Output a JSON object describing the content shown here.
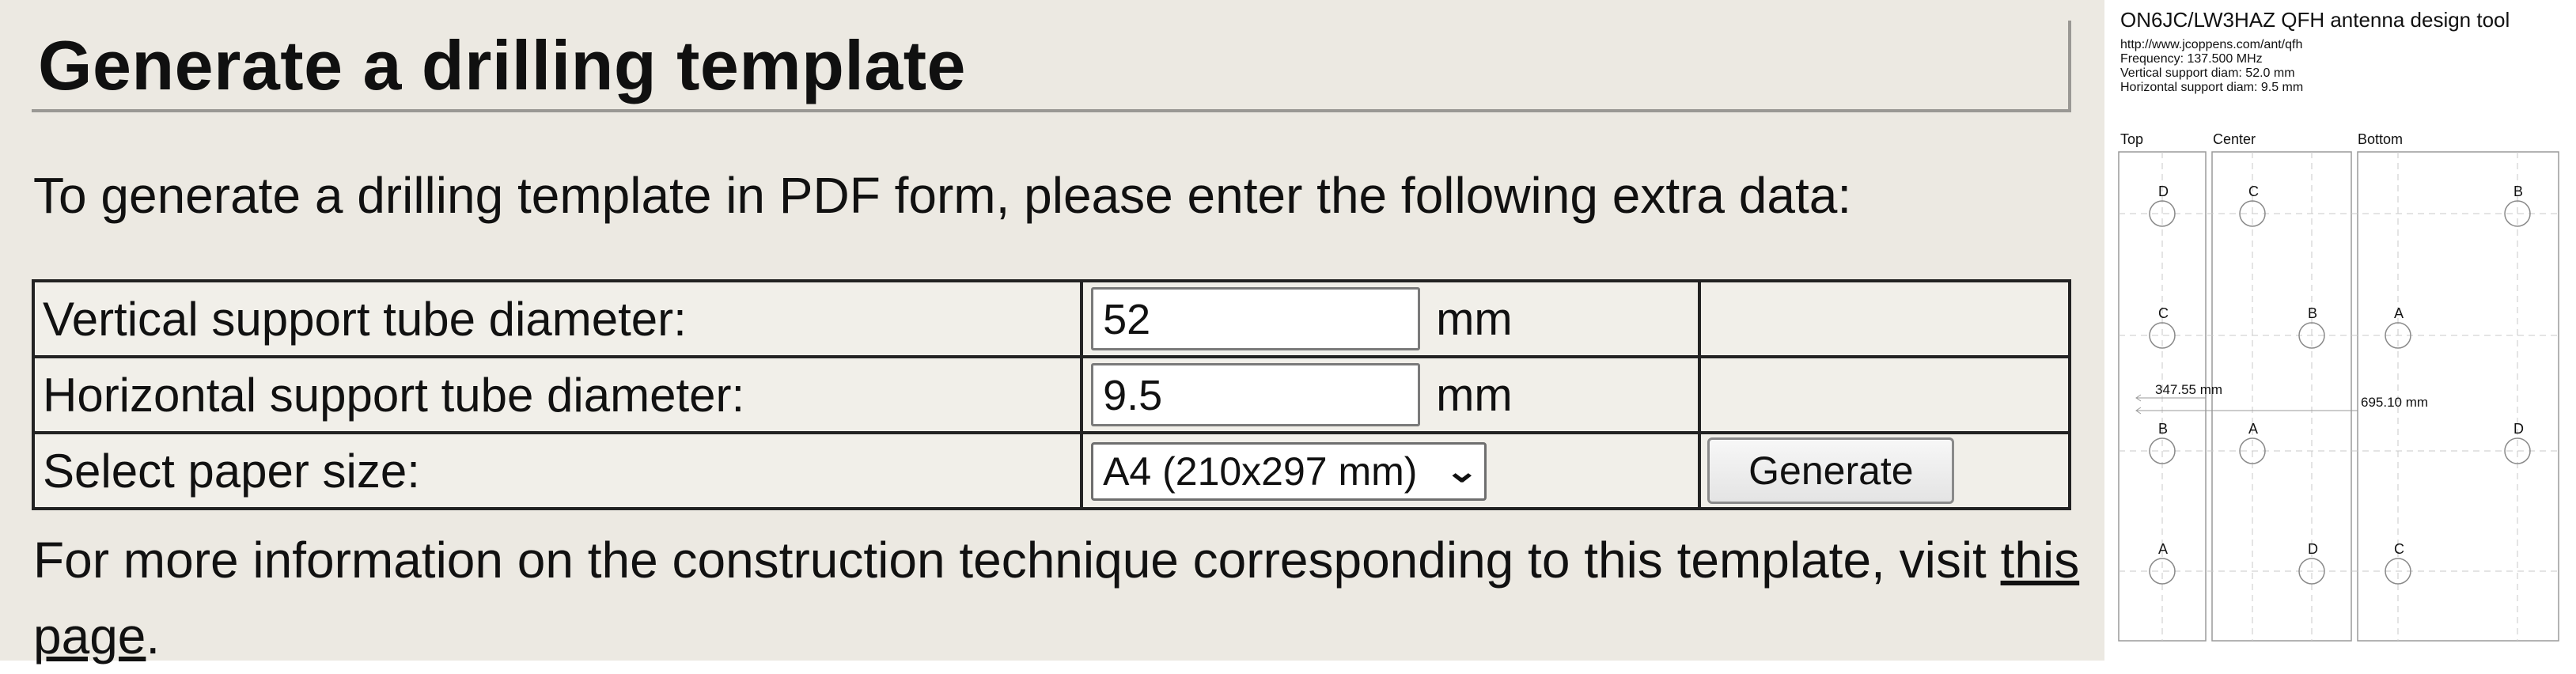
{
  "form": {
    "heading": "Generate a drilling template",
    "intro": "To generate a drilling template in PDF form, please enter the following extra data:",
    "rows": [
      {
        "label": "Vertical support tube diameter:",
        "value": "52",
        "unit": "mm"
      },
      {
        "label": "Horizontal support tube diameter:",
        "value": "9.5",
        "unit": "mm"
      },
      {
        "label": "Select paper size:",
        "selected": "A4 (210x297 mm)",
        "button": "Generate"
      }
    ],
    "more_info_text": "For more information on the construction technique corresponding to this template, visit ",
    "more_info_link": "this page",
    "more_info_end": "."
  },
  "preview": {
    "title": "ON6JC/LW3HAZ QFH antenna design tool",
    "lines": [
      "http://www.jcoppens.com/ant/qfh",
      "Frequency: 137.500 MHz",
      "Vertical support diam: 52.0 mm",
      "Horizontal support diam: 9.5 mm"
    ],
    "columns": [
      "Top",
      "Center",
      "Bottom"
    ],
    "dimension_1": "347.55 mm",
    "dimension_2": "695.10 mm",
    "hole_labels": {
      "top": [
        "D",
        "C",
        "B",
        "A"
      ],
      "center_left": [
        "C",
        "A"
      ],
      "center_right": [
        "B",
        "D"
      ],
      "bottom_left": [
        "A",
        "C"
      ],
      "bottom_right": [
        "B",
        "D"
      ]
    }
  }
}
